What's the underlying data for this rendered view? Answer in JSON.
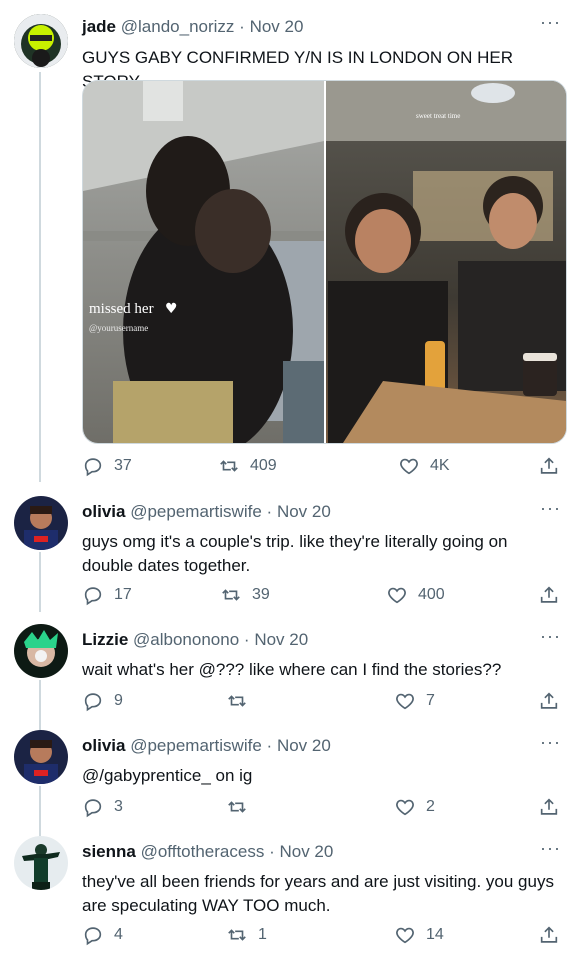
{
  "tweets": [
    {
      "name": "jade",
      "handle": "@lando_norizz",
      "date": "Nov 20",
      "text": "GUYS GABY CONFIRMED Y/N IS IN LONDON ON HER STORY",
      "replies": "37",
      "retweets": "409",
      "likes": "4K"
    },
    {
      "name": "olivia",
      "handle": "@pepemartiswife",
      "date": "Nov 20",
      "text": "guys omg it's a couple's trip. like they're literally going on double dates together.",
      "replies": "17",
      "retweets": "39",
      "likes": "400"
    },
    {
      "name": "Lizzie",
      "handle": "@albononono",
      "date": "Nov 20",
      "text": "wait what's her @??? like where can I find the stories??",
      "replies": "9",
      "retweets": "",
      "likes": "7"
    },
    {
      "name": "olivia",
      "handle": "@pepemartiswife",
      "date": "Nov 20",
      "text": "@/gabyprentice_ on ig",
      "replies": "3",
      "retweets": "",
      "likes": "2"
    },
    {
      "name": "sienna",
      "handle": "@offtotheracess",
      "date": "Nov 20",
      "text": "they've all been friends for years and are just visiting. you guys are speculating WAY TOO much.",
      "replies": "4",
      "retweets": "1",
      "likes": "14"
    }
  ],
  "media": {
    "left_caption": "missed her",
    "left_subcaption": "@yourusername",
    "right_caption": "sweet treat time"
  },
  "more_glyph": "···",
  "separator": "·"
}
